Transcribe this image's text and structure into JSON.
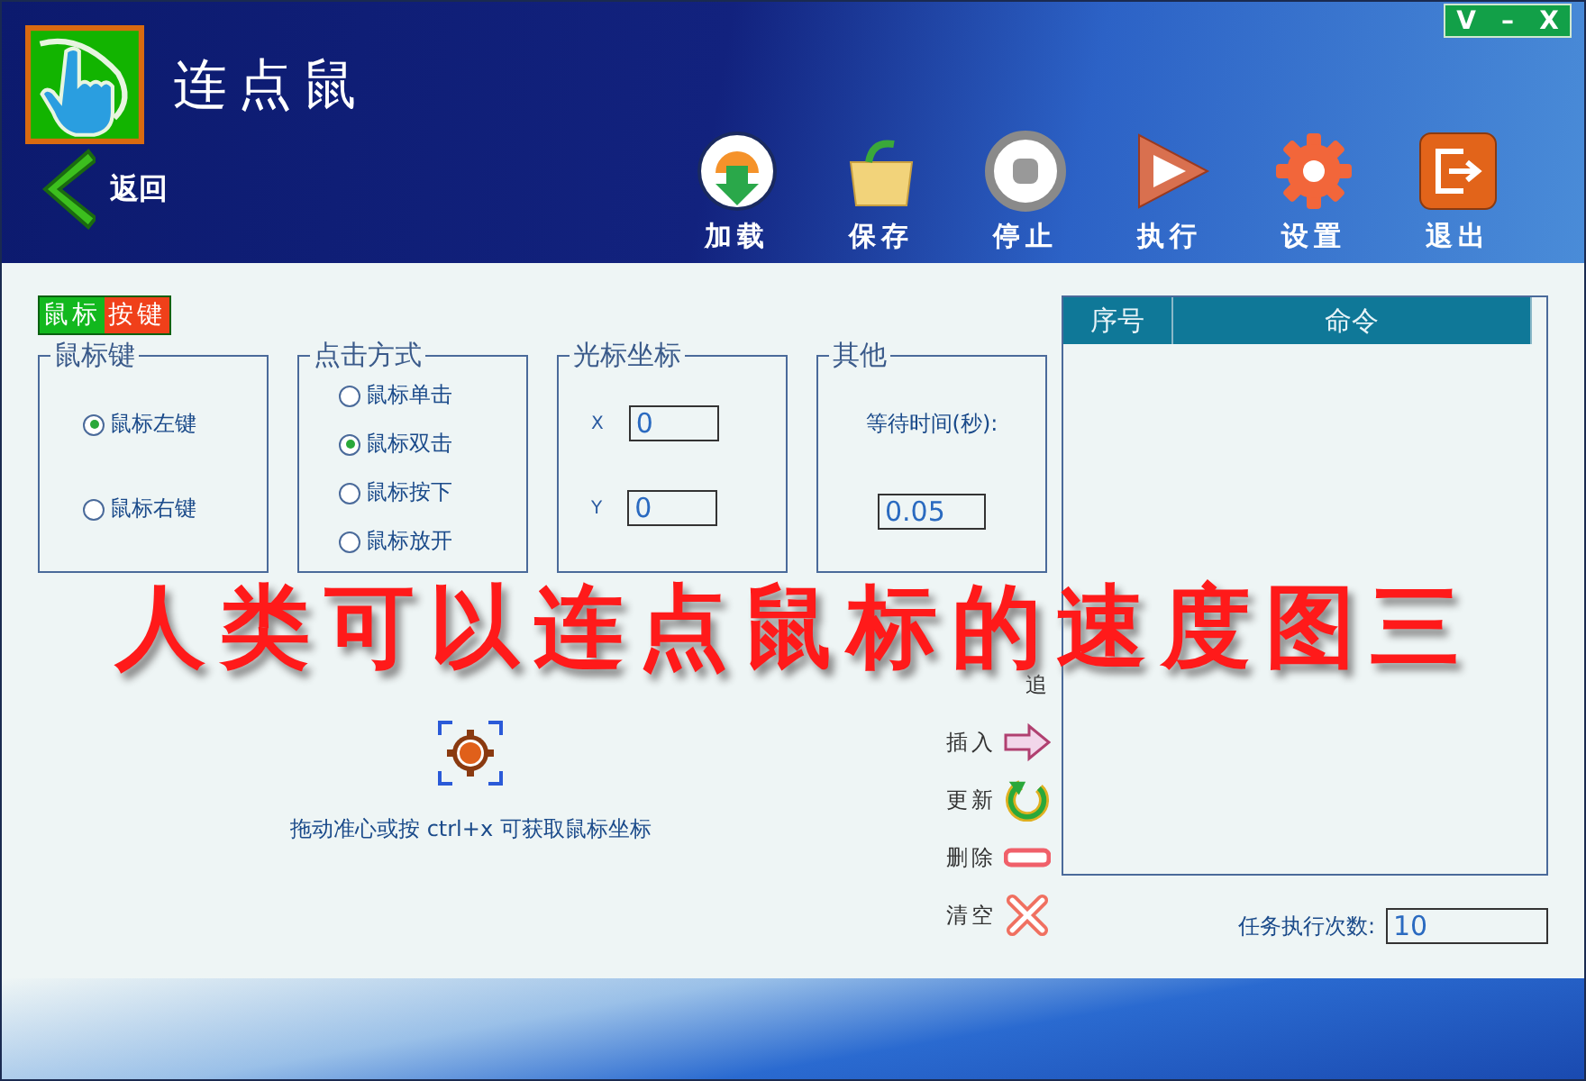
{
  "window": {
    "title": "连点鼠",
    "controls": [
      "V",
      "–",
      "X"
    ]
  },
  "back": {
    "label": "返回"
  },
  "toolbar": [
    {
      "label": "加载",
      "kind": "load"
    },
    {
      "label": "保存",
      "kind": "save"
    },
    {
      "label": "停止",
      "kind": "stop"
    },
    {
      "label": "执行",
      "kind": "run"
    },
    {
      "label": "设置",
      "kind": "settings"
    },
    {
      "label": "退出",
      "kind": "exit"
    }
  ],
  "section_tag": [
    {
      "text": "鼠标",
      "color": "#12b81e"
    },
    {
      "text": "按键",
      "color": "#f0401a"
    }
  ],
  "mouse_button": {
    "title": "鼠标键",
    "options": [
      {
        "label": "鼠标左键",
        "selected": true
      },
      {
        "label": "鼠标右键",
        "selected": false
      }
    ]
  },
  "click_mode": {
    "title": "点击方式",
    "options": [
      {
        "label": "鼠标单击",
        "selected": false
      },
      {
        "label": "鼠标双击",
        "selected": true
      },
      {
        "label": "鼠标按下",
        "selected": false
      },
      {
        "label": "鼠标放开",
        "selected": false
      }
    ]
  },
  "cursor": {
    "title": "光标坐标",
    "fields": [
      {
        "label": "X",
        "value": "0"
      },
      {
        "label": "Y",
        "value": "0"
      }
    ]
  },
  "other": {
    "title": "其他",
    "label": "等待时间(秒):",
    "value": "0.05"
  },
  "crosshair_hint": "拖动准心或按 ctrl+x 可获取鼠标坐标",
  "actions": [
    {
      "label": "追",
      "kind": "append"
    },
    {
      "label": "插入",
      "kind": "insert"
    },
    {
      "label": "更新",
      "kind": "update"
    },
    {
      "label": "删除",
      "kind": "delete"
    },
    {
      "label": "清空",
      "kind": "clear"
    }
  ],
  "table": {
    "columns": [
      "序号",
      "命令"
    ]
  },
  "task_count": {
    "label": "任务执行次数:",
    "value": "10"
  },
  "overlay_caption": "人类可以连点鼠标的速度图三"
}
